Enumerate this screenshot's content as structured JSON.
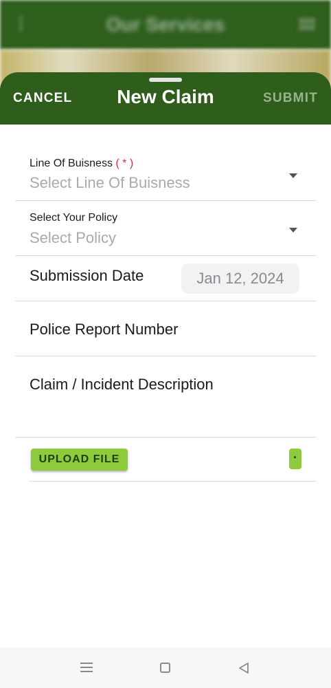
{
  "background": {
    "title": "Our Services"
  },
  "sheet": {
    "cancel_label": "CANCEL",
    "title": "New Claim",
    "submit_label": "SUBMIT"
  },
  "fields": {
    "line_of_business": {
      "label": "Line Of Buisness",
      "required_marker": "( * )",
      "placeholder": "Select Line Of Buisness"
    },
    "policy": {
      "label": "Select Your Policy",
      "placeholder": "Select Policy"
    },
    "submission_date": {
      "label": "Submission Date",
      "value": "Jan 12, 2024"
    },
    "police_report": {
      "label": "Police Report Number"
    },
    "description": {
      "label": "Claim / Incident Description"
    }
  },
  "upload": {
    "button_label": "UPLOAD FILE",
    "secondary_label": "·"
  },
  "icons": {
    "dropdown": "chevron-down-icon",
    "nav_menu": "menu-icon",
    "nav_home": "home-square-icon",
    "nav_back": "back-triangle-icon"
  },
  "colors": {
    "header_green": "#2f5e1c",
    "accent_green": "#8ecb3c",
    "required_red": "#d32f2f"
  }
}
